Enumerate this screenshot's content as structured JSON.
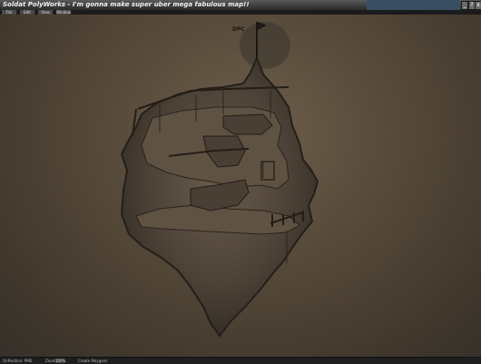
{
  "window": {
    "title": "Soldat PolyWorks - I'm gonna make super uber mega fabulous map!!",
    "buttons": {
      "minimize": "_",
      "help": "?",
      "close": "x"
    }
  },
  "menu": [
    {
      "label": "File"
    },
    {
      "label": "Edit"
    },
    {
      "label": "View"
    },
    {
      "label": "Window"
    }
  ],
  "map": {
    "flag_label": "DPC"
  },
  "statusbar": {
    "tool": "OnPosition: PME",
    "zoom_label": "Zoom:",
    "zoom_value": "100%",
    "mode": "Create Polygons"
  }
}
